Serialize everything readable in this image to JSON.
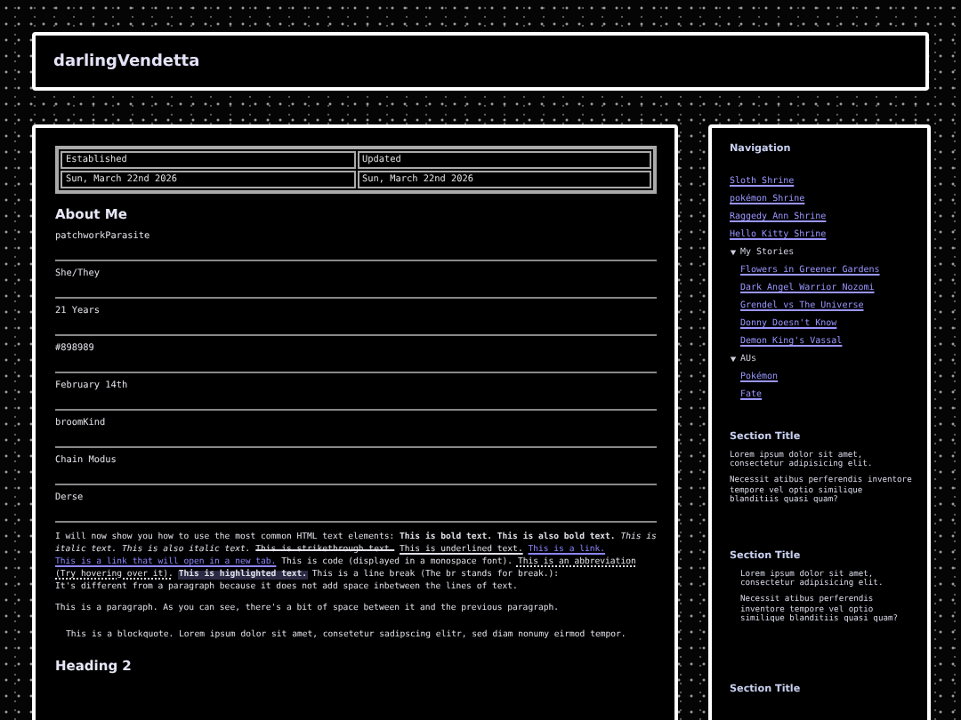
{
  "header": {
    "title": "darlingVendetta"
  },
  "info_table": {
    "columns": [
      "Established",
      "Updated"
    ],
    "rows": [
      [
        "Sun, March 22nd 2026",
        "Sun, March 22nd 2026"
      ]
    ]
  },
  "about": {
    "heading": "About Me",
    "items": [
      "patchworkParasite",
      "She/They",
      "21 Years",
      "#898989",
      "February 14th",
      "broomKind",
      "Chain Modus",
      "Derse"
    ]
  },
  "content": [
    {
      "kind": "rich",
      "segments": [
        {
          "kind": "text",
          "text": "I will now show you how to use the most common HTML text elements: "
        },
        {
          "kind": "bold",
          "text": "This is bold text."
        },
        {
          "kind": "bold",
          "text": "This is also bold text."
        },
        {
          "kind": "italic",
          "text": "This is italic text."
        },
        {
          "kind": "italic",
          "text": "This is also italic text."
        },
        {
          "kind": "strike",
          "text": "This is strikethrough text."
        },
        {
          "kind": "underline",
          "text": "This is underlined text."
        },
        {
          "kind": "link",
          "text": "This is a link."
        },
        {
          "kind": "link",
          "text": "This is a link that will open in a new tab."
        },
        {
          "kind": "text",
          "text": " This is code (displayed in a monospace font). "
        },
        {
          "kind": "abbr",
          "text": "This is an abbreviation (Try hovering over it)."
        },
        {
          "kind": "mark",
          "text": "This is highlighted text."
        },
        {
          "kind": "text",
          "text": " This is a line break (The br stands for break.):"
        },
        {
          "kind": "break"
        },
        {
          "kind": "text",
          "text": "It's different from a paragraph because it does not add space inbetween the lines of text."
        }
      ]
    },
    {
      "kind": "paragraph",
      "text": "This is a paragraph. As you can see, there's a bit of space between it and the previous paragraph."
    },
    {
      "kind": "blockquote",
      "text": "This is a blockquote. Lorem ipsum dolor sit amet, consetetur sadipscing elitr, sed diam nonumy eirmod tempor."
    },
    {
      "kind": "heading",
      "text": "Heading 2"
    }
  ],
  "sidebar": {
    "navigation": {
      "title": "Navigation",
      "items": [
        {
          "kind": "link",
          "label": "Sloth Shrine"
        },
        {
          "kind": "link",
          "label": "pokémon Shrine"
        },
        {
          "kind": "link",
          "label": "Raggedy Ann Shrine"
        },
        {
          "kind": "link",
          "label": "Hello Kitty Shrine"
        },
        {
          "kind": "folder",
          "label": "My Stories",
          "expanded": true,
          "children": [
            {
              "kind": "link",
              "label": "Flowers in Greener Gardens"
            },
            {
              "kind": "link",
              "label": "Dark Angel Warrior Nozomi"
            },
            {
              "kind": "link",
              "label": "Grendel vs The Universe"
            },
            {
              "kind": "link",
              "label": "Donny Doesn't Know"
            },
            {
              "kind": "link",
              "label": "Demon King's Vassal"
            }
          ]
        },
        {
          "kind": "folder",
          "label": "AUs",
          "expanded": true,
          "children": [
            {
              "kind": "link",
              "label": "Pokémon"
            },
            {
              "kind": "link",
              "label": "Fate"
            }
          ]
        }
      ]
    },
    "sections": [
      {
        "kind": "plain",
        "title": "Section Title",
        "paragraphs": [
          "Lorem ipsum dolor sit amet, consectetur adipisicing elit.",
          "Necessit atibus perferendis inventore tempore vel optio similique blanditiis quasi quam?"
        ]
      },
      {
        "kind": "quote",
        "title": "Section Title",
        "paragraphs": [
          "Lorem ipsum dolor sit amet, consectetur adipisicing elit.",
          "Necessit atibus perferendis inventore tempore vel optio similique blanditiis quasi quam?"
        ]
      },
      {
        "kind": "plain",
        "title": "Section Title"
      }
    ]
  }
}
